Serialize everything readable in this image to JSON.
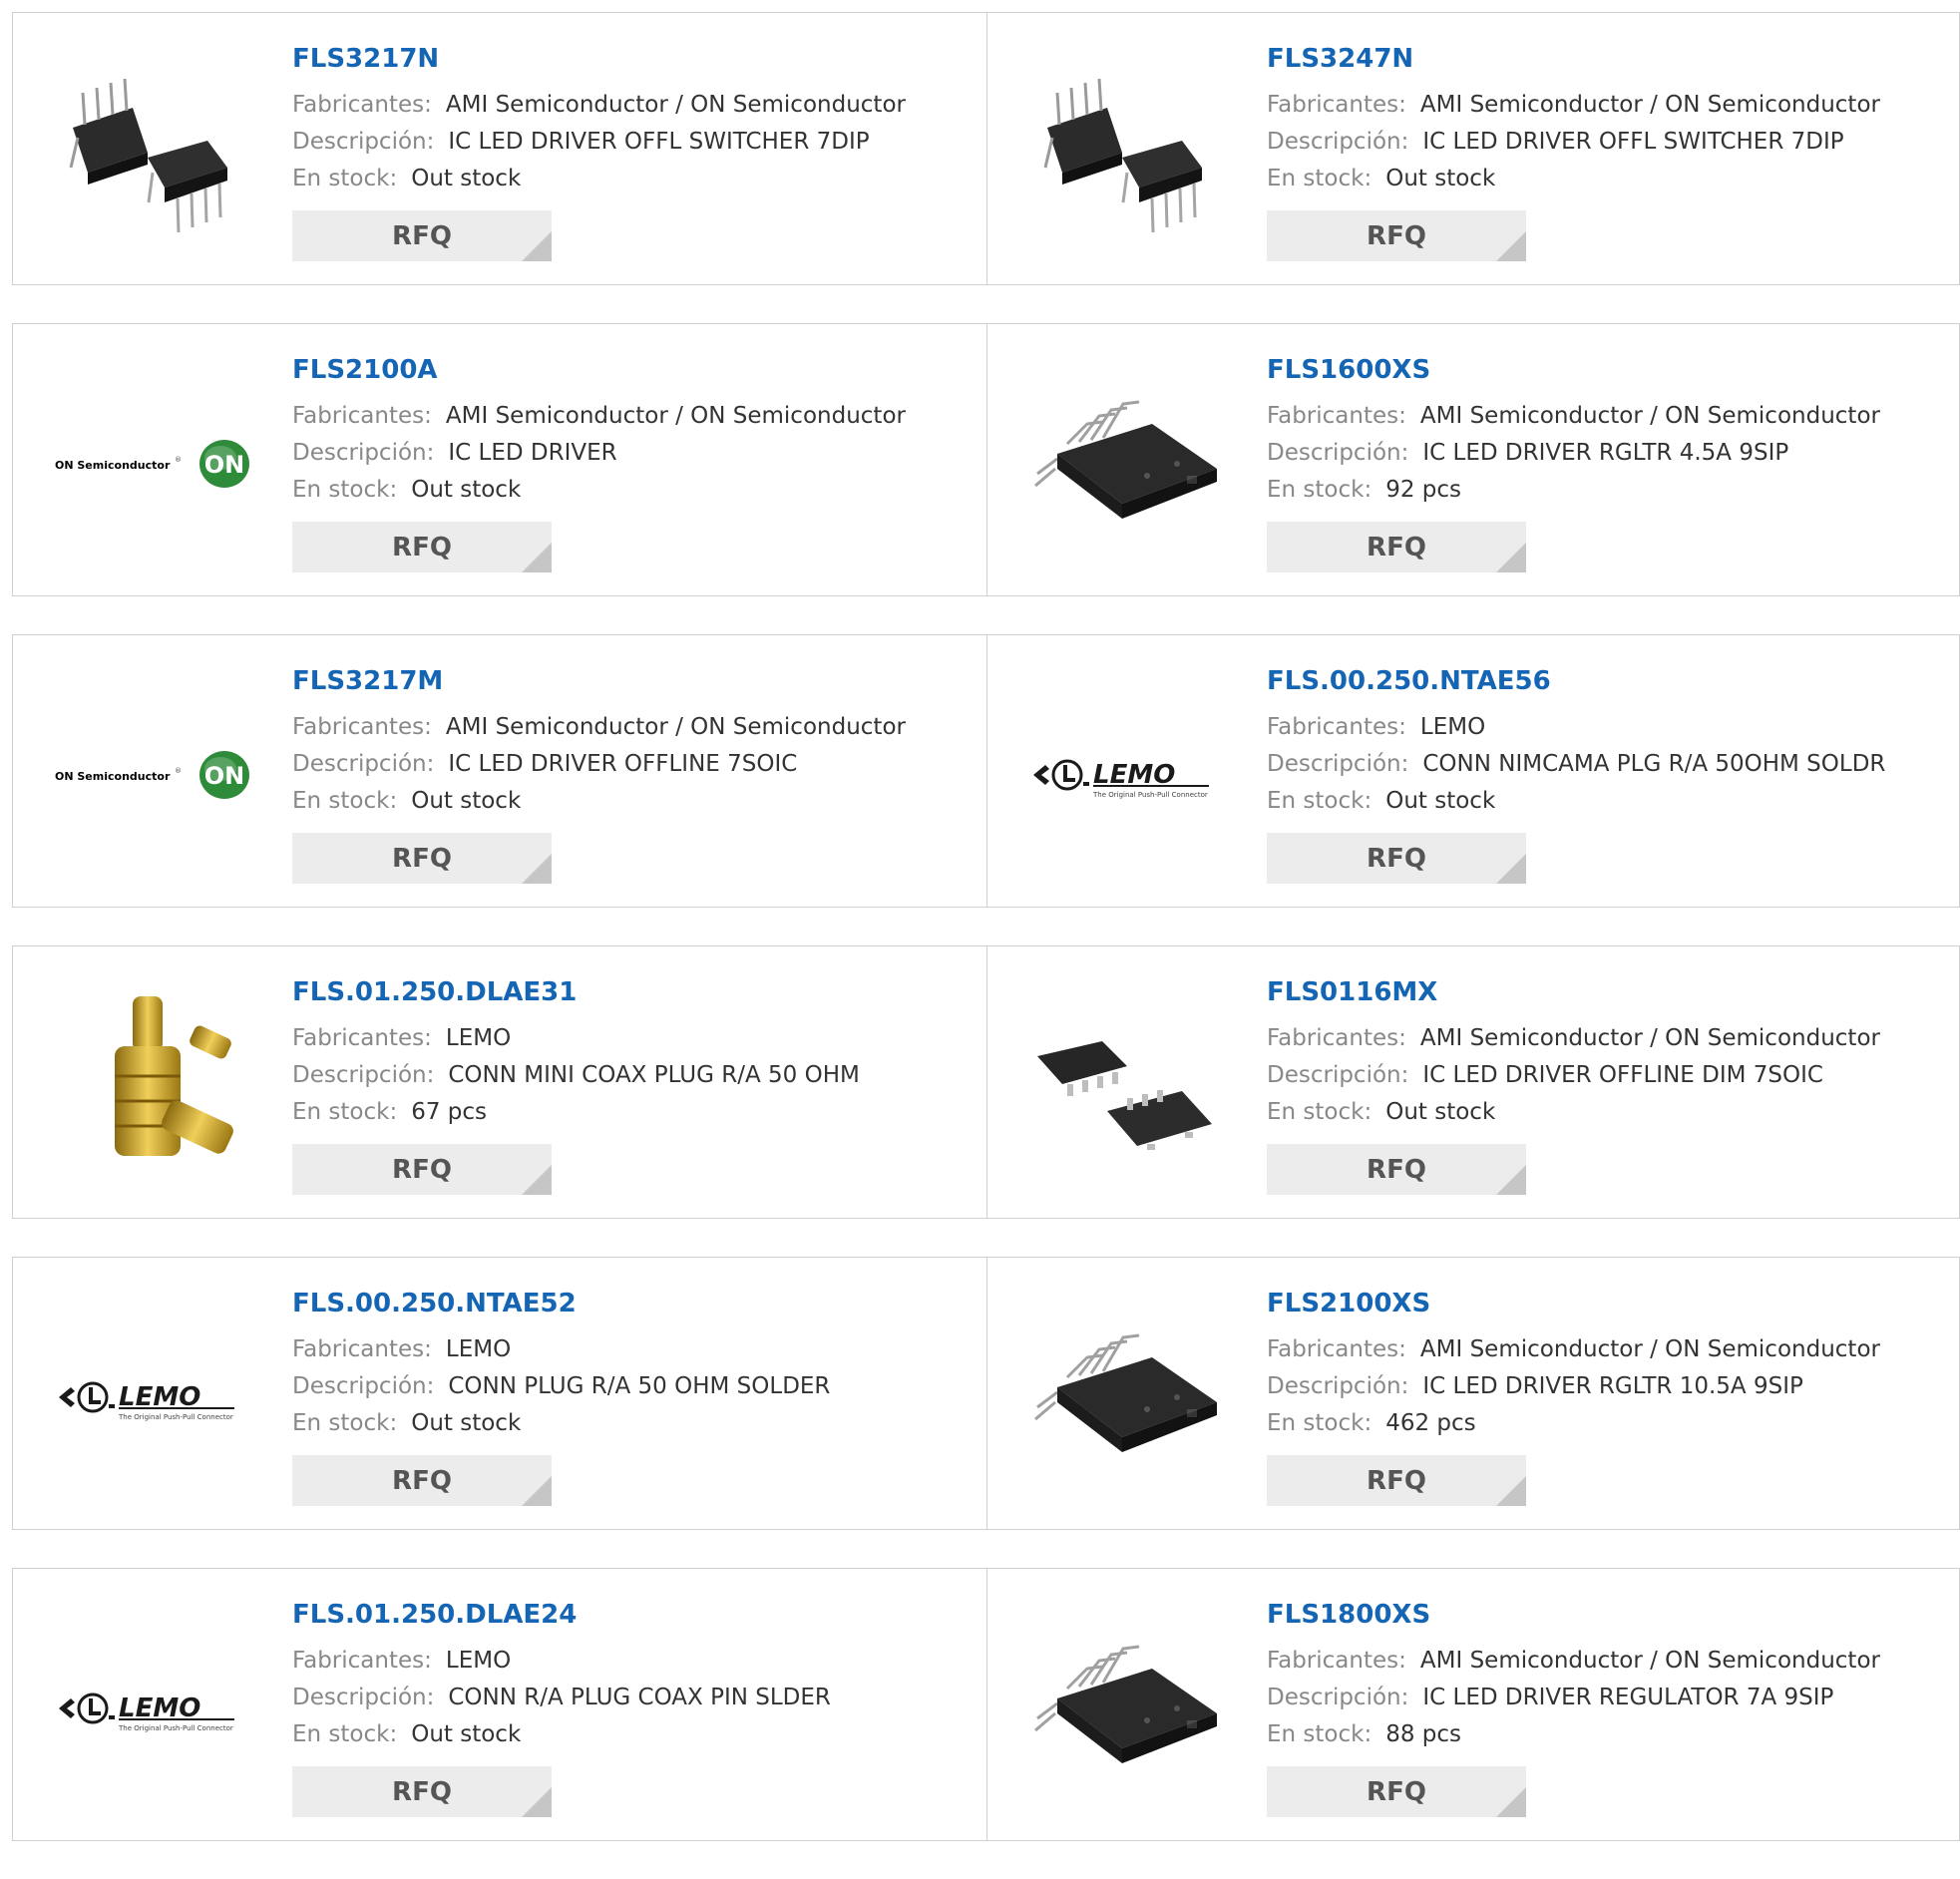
{
  "labels": {
    "manufacturer": "Fabricantes:",
    "description": "Descripción:",
    "stock": "En stock:",
    "rfq": "RFQ"
  },
  "logo_text": {
    "on": "ON Semiconductor",
    "on_mark": "ON",
    "lemo": "LEMO",
    "lemo_tag": "The Original Push-Pull Connector"
  },
  "colors": {
    "link": "#1565b5",
    "button_bg": "#ececec",
    "border": "#cfcfcf"
  },
  "products": [
    {
      "part": "FLS3217N",
      "manufacturer": "AMI Semiconductor / ON Semiconductor",
      "description": "IC LED DRIVER OFFL SWITCHER 7DIP",
      "stock": "Out stock",
      "image": "dip-package-icon"
    },
    {
      "part": "FLS3247N",
      "manufacturer": "AMI Semiconductor / ON Semiconductor",
      "description": "IC LED DRIVER OFFL SWITCHER 7DIP",
      "stock": "Out stock",
      "image": "dip-package-icon"
    },
    {
      "part": "FLS2100A",
      "manufacturer": "AMI Semiconductor / ON Semiconductor",
      "description": "IC LED DRIVER",
      "stock": "Out stock",
      "image": "on-semiconductor-logo"
    },
    {
      "part": "FLS1600XS",
      "manufacturer": "AMI Semiconductor / ON Semiconductor",
      "description": "IC LED DRIVER RGLTR 4.5A 9SIP",
      "stock": "92 pcs",
      "image": "sip-package-icon"
    },
    {
      "part": "FLS3217M",
      "manufacturer": "AMI Semiconductor / ON Semiconductor",
      "description": "IC LED DRIVER OFFLINE 7SOIC",
      "stock": "Out stock",
      "image": "on-semiconductor-logo"
    },
    {
      "part": "FLS.00.250.NTAE56",
      "manufacturer": "LEMO",
      "description": "CONN NIMCAMA PLG R/A 50OHM SOLDR",
      "stock": "Out stock",
      "image": "lemo-logo"
    },
    {
      "part": "FLS.01.250.DLAE31",
      "manufacturer": "LEMO",
      "description": "CONN MINI COAX PLUG R/A 50 OHM",
      "stock": "67 pcs",
      "image": "coax-connector-icon"
    },
    {
      "part": "FLS0116MX",
      "manufacturer": "AMI Semiconductor / ON Semiconductor",
      "description": "IC LED DRIVER OFFLINE DIM 7SOIC",
      "stock": "Out stock",
      "image": "soic-package-icon"
    },
    {
      "part": "FLS.00.250.NTAE52",
      "manufacturer": "LEMO",
      "description": "CONN PLUG R/A 50 OHM SOLDER",
      "stock": "Out stock",
      "image": "lemo-logo"
    },
    {
      "part": "FLS2100XS",
      "manufacturer": "AMI Semiconductor / ON Semiconductor",
      "description": "IC LED DRIVER RGLTR 10.5A 9SIP",
      "stock": "462 pcs",
      "image": "sip-package-icon"
    },
    {
      "part": "FLS.01.250.DLAE24",
      "manufacturer": "LEMO",
      "description": "CONN R/A PLUG COAX PIN SLDER",
      "stock": "Out stock",
      "image": "lemo-logo"
    },
    {
      "part": "FLS1800XS",
      "manufacturer": "AMI Semiconductor / ON Semiconductor",
      "description": "IC LED DRIVER REGULATOR 7A 9SIP",
      "stock": "88 pcs",
      "image": "sip-package-icon"
    }
  ]
}
